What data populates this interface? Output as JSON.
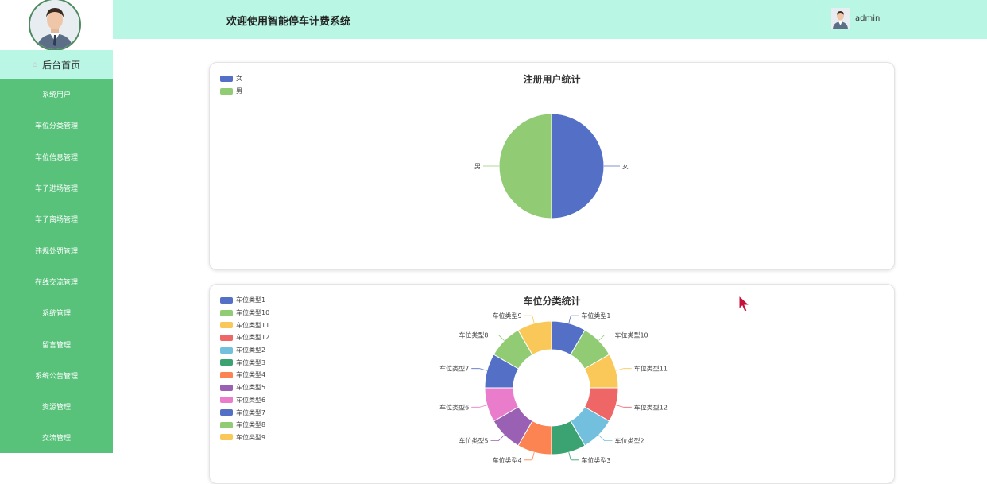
{
  "sidebar": {
    "home_label": "后台首页",
    "items": [
      {
        "label": "系统用户"
      },
      {
        "label": "车位分类管理"
      },
      {
        "label": "车位信息管理"
      },
      {
        "label": "车子进场管理"
      },
      {
        "label": "车子离场管理"
      },
      {
        "label": "违规处罚管理"
      },
      {
        "label": "在线交流管理"
      },
      {
        "label": "系统管理"
      },
      {
        "label": "留言管理"
      },
      {
        "label": "系统公告管理"
      },
      {
        "label": "资源管理"
      },
      {
        "label": "交流管理"
      }
    ]
  },
  "header": {
    "title": "欢迎使用智能停车计费系统",
    "username": "admin"
  },
  "colors": {
    "sidebar_bg": "#58c27b",
    "header_bg": "#b9f7e4",
    "palette": [
      "#5470c6",
      "#91cc75",
      "#fac858",
      "#ee6666",
      "#73c0de",
      "#3ba272",
      "#fc8452",
      "#9a60b4",
      "#ea7ccc"
    ]
  },
  "chart_data": [
    {
      "type": "pie",
      "title": "注册用户统计",
      "legend_position": "top-left",
      "categories": [
        "女",
        "男"
      ],
      "values": [
        1,
        1
      ]
    },
    {
      "type": "pie",
      "title": "车位分类统计",
      "legend_position": "top-left",
      "donut": true,
      "categories": [
        "车位类型1",
        "车位类型10",
        "车位类型11",
        "车位类型12",
        "车位类型2",
        "车位类型3",
        "车位类型4",
        "车位类型5",
        "车位类型6",
        "车位类型7",
        "车位类型8",
        "车位类型9"
      ],
      "values": [
        1,
        1,
        1,
        1,
        1,
        1,
        1,
        1,
        1,
        1,
        1,
        1
      ]
    }
  ]
}
